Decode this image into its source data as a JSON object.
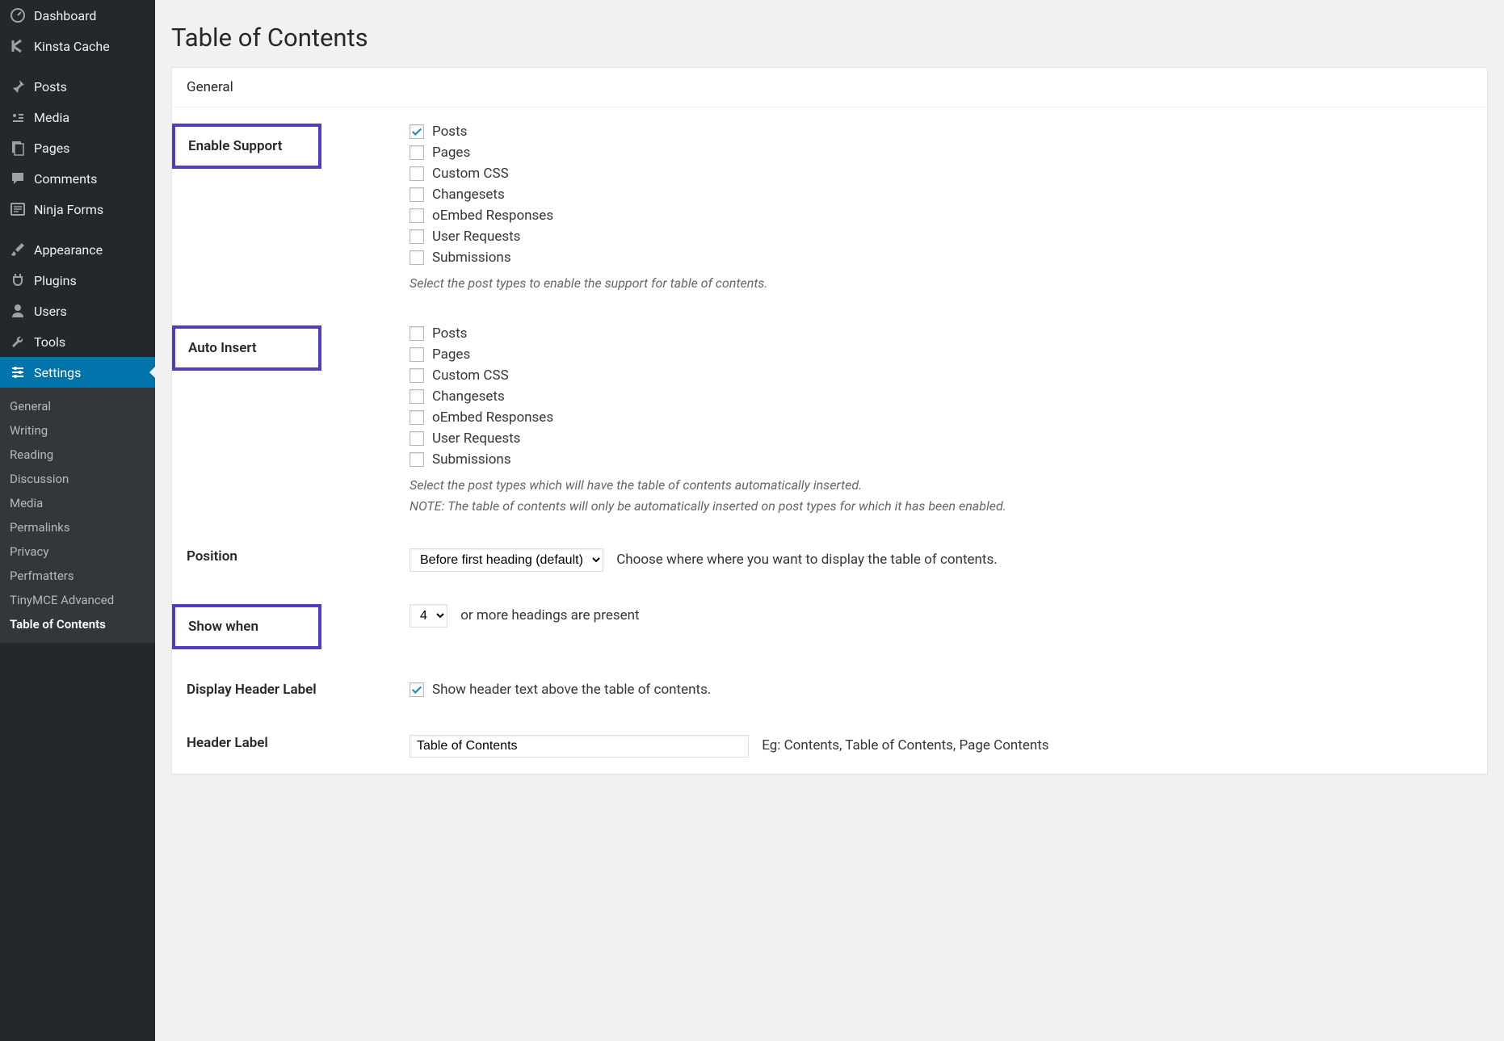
{
  "sidebar": {
    "items": [
      {
        "label": "Dashboard",
        "icon": "dashboard"
      },
      {
        "label": "Kinsta Cache",
        "icon": "kinsta"
      },
      {
        "label": "Posts",
        "icon": "pin"
      },
      {
        "label": "Media",
        "icon": "media"
      },
      {
        "label": "Pages",
        "icon": "page"
      },
      {
        "label": "Comments",
        "icon": "comment"
      },
      {
        "label": "Ninja Forms",
        "icon": "form"
      },
      {
        "label": "Appearance",
        "icon": "brush"
      },
      {
        "label": "Plugins",
        "icon": "plug"
      },
      {
        "label": "Users",
        "icon": "user"
      },
      {
        "label": "Tools",
        "icon": "wrench"
      },
      {
        "label": "Settings",
        "icon": "sliders"
      }
    ],
    "submenu": [
      "General",
      "Writing",
      "Reading",
      "Discussion",
      "Media",
      "Permalinks",
      "Privacy",
      "Perfmatters",
      "TinyMCE Advanced",
      "Table of Contents"
    ]
  },
  "page": {
    "title": "Table of Contents",
    "tab": "General"
  },
  "enable_support": {
    "label": "Enable Support",
    "options": [
      "Posts",
      "Pages",
      "Custom CSS",
      "Changesets",
      "oEmbed Responses",
      "User Requests",
      "Submissions"
    ],
    "checked": [
      true,
      false,
      false,
      false,
      false,
      false,
      false
    ],
    "desc": "Select the post types to enable the support for table of contents."
  },
  "auto_insert": {
    "label": "Auto Insert",
    "options": [
      "Posts",
      "Pages",
      "Custom CSS",
      "Changesets",
      "oEmbed Responses",
      "User Requests",
      "Submissions"
    ],
    "checked": [
      false,
      false,
      false,
      false,
      false,
      false,
      false
    ],
    "desc1": "Select the post types which will have the table of contents automatically inserted.",
    "desc2": "NOTE: The table of contents will only be automatically inserted on post types for which it has been enabled."
  },
  "position": {
    "label": "Position",
    "value": "Before first heading (default)",
    "hint": "Choose where where you want to display the table of contents."
  },
  "show_when": {
    "label": "Show when",
    "value": "4",
    "hint": "or more headings are present"
  },
  "display_header": {
    "label": "Display Header Label",
    "checked": true,
    "text": "Show header text above the table of contents."
  },
  "header_label": {
    "label": "Header Label",
    "value": "Table of Contents",
    "hint": "Eg: Contents, Table of Contents, Page Contents"
  }
}
